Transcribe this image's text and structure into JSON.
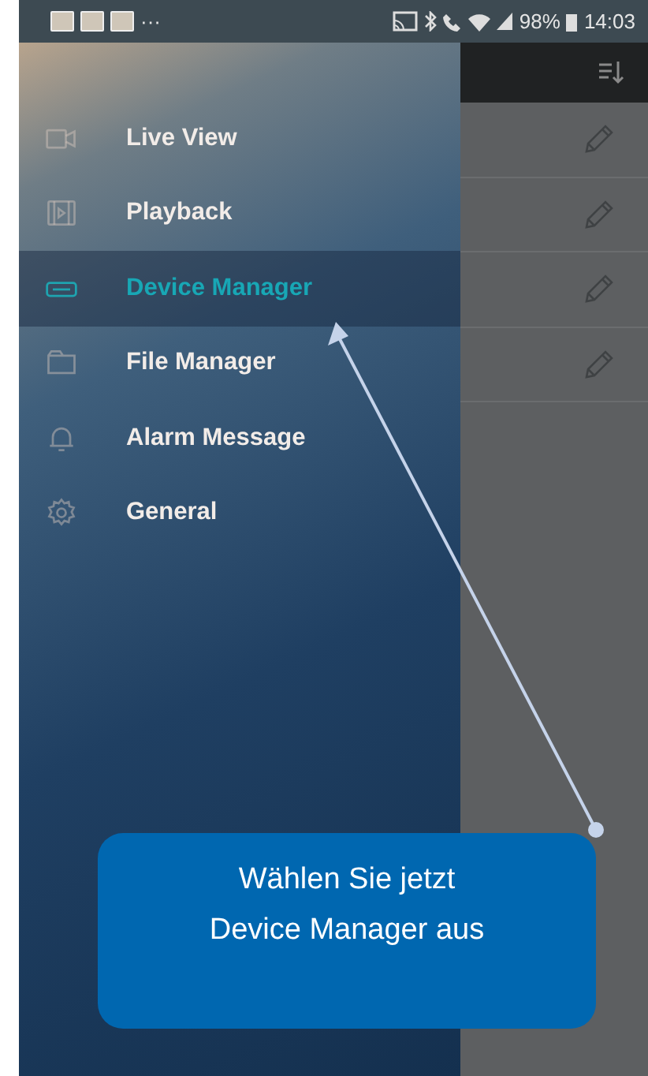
{
  "status_bar": {
    "overflow": "···",
    "battery": "98%",
    "time": "14:03"
  },
  "drawer": {
    "items": [
      {
        "label": "Live View",
        "selected": false
      },
      {
        "label": "Playback",
        "selected": false
      },
      {
        "label": "Device Manager",
        "selected": true
      },
      {
        "label": "File Manager",
        "selected": false
      },
      {
        "label": "Alarm Message",
        "selected": false
      },
      {
        "label": "General",
        "selected": false
      }
    ]
  },
  "callout": {
    "lines": [
      "Wählen Sie jetzt",
      "Device Manager aus"
    ]
  }
}
